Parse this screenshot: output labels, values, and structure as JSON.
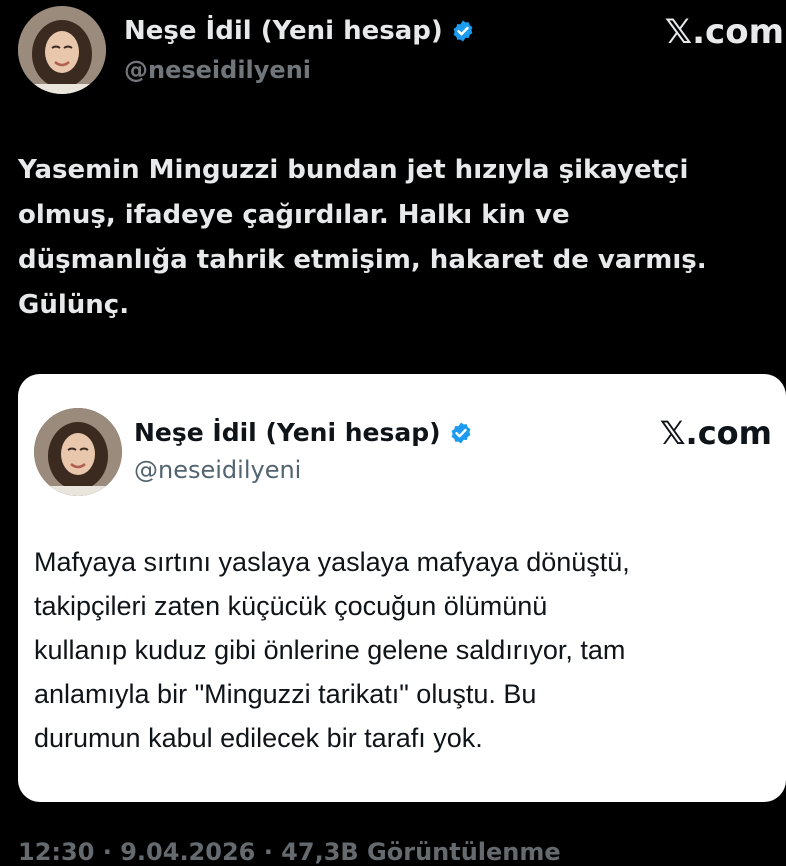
{
  "outer_tweet": {
    "display_name": "Neşe İdil (Yeni hesap)",
    "handle": "@neseidilyeni",
    "brand": "𝕏.com",
    "verified_badge_icon": "verified-badge-icon",
    "text_lines": [
      "Yasemin Minguzzi bundan jet hızıyla şikayetçi",
      "olmuş, ifadeye çağırdılar. Halkı kin ve",
      "düşmanlığa tahrik etmişim, hakaret de varmış.",
      "Gülünç."
    ]
  },
  "quoted_tweet": {
    "display_name": "Neşe İdil (Yeni hesap)",
    "handle": "@neseidilyeni",
    "brand": "𝕏.com",
    "verified_badge_icon": "verified-badge-icon",
    "text_lines": [
      "Mafyaya sırtını yaslaya yaslaya mafyaya dönüştü,",
      "takipçileri zaten küçücük çocuğun ölümünü",
      "kullanıp kuduz gibi önlerine gelene saldırıyor, tam",
      "anlamıyla bir \"Minguzzi tarikatı\" oluştu. Bu",
      "durumun kabul edilecek bir tarafı yok."
    ]
  },
  "footer": {
    "meta": "12:30 · 9.04.2026 · 47,3B Görüntülenme"
  },
  "colors": {
    "background": "#000000",
    "verified_blue": "#1d9bf0",
    "card_background": "#ffffff"
  }
}
